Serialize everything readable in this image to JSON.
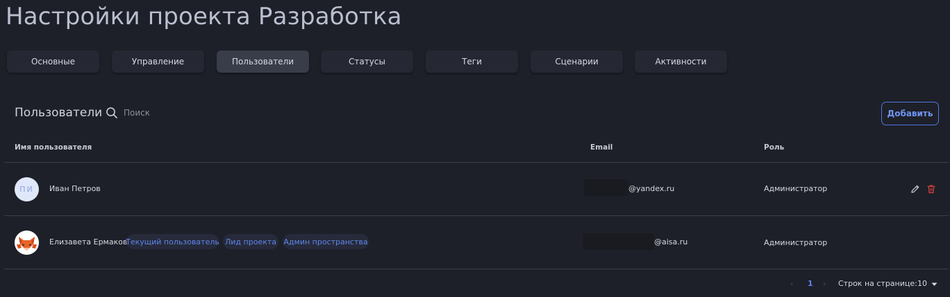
{
  "page": {
    "title": "Настройки проекта Разработка"
  },
  "tabs": [
    {
      "label": "Основные",
      "active": false
    },
    {
      "label": "Управление",
      "active": false
    },
    {
      "label": "Пользователи",
      "active": true
    },
    {
      "label": "Статусы",
      "active": false
    },
    {
      "label": "Теги",
      "active": false
    },
    {
      "label": "Сценарии",
      "active": false
    },
    {
      "label": "Активности",
      "active": false
    }
  ],
  "users_section": {
    "title": "Пользователи",
    "search_placeholder": "Поиск",
    "add_label": "Добавить"
  },
  "table": {
    "headers": {
      "name": "Имя пользователя",
      "email": "Email",
      "role": "Роль"
    },
    "rows": [
      {
        "avatar_initials": "ПИ",
        "name": "Иван Петров",
        "badges": [],
        "email_visible": "@yandex.ru",
        "role": "Администратор",
        "actions": [
          "edit-icon",
          "delete-icon"
        ]
      },
      {
        "avatar_initials": "",
        "name": "Елизавета Ермакова",
        "badges": [
          "Текущий пользователь",
          "Лид проекта",
          "Админ пространства"
        ],
        "email_visible": "@aisa.ru",
        "role": "Администратор",
        "actions": []
      }
    ]
  },
  "pagination": {
    "current_page": "1",
    "rows_label": "Строк на странице:",
    "rows_per_page": "10"
  },
  "colors": {
    "background": "#1e2029",
    "accent": "#5f86ea",
    "delete": "#d9443a"
  }
}
